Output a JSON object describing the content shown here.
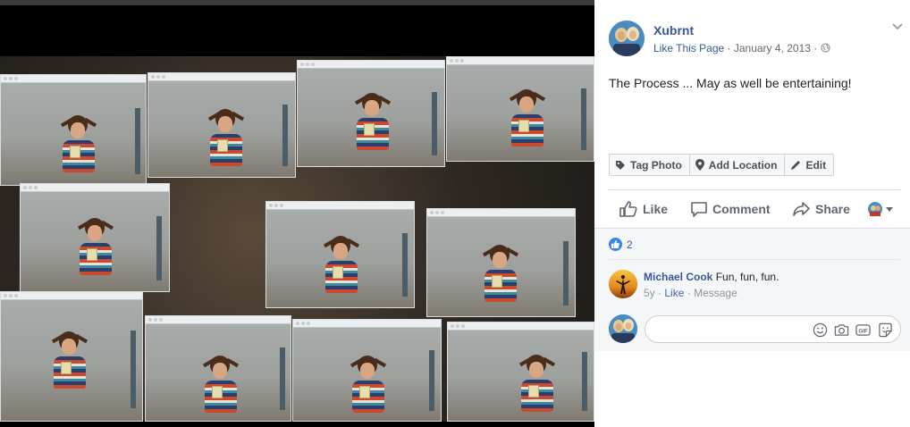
{
  "post": {
    "author": "Xubrnt",
    "like_page": "Like This Page",
    "separator": "·",
    "date": "January 4, 2013",
    "privacy_icon": "globe-icon",
    "menu_icon": "chevron-down-icon",
    "caption": "The Process ... May as well be entertaining!"
  },
  "photo_actions": {
    "tag": "Tag Photo",
    "location": "Add Location",
    "edit": "Edit"
  },
  "reactions": {
    "like": "Like",
    "comment": "Comment",
    "share": "Share"
  },
  "likes": {
    "count": "2"
  },
  "comment": {
    "name": "Michael Cook",
    "text": "Fun, fun, fun.",
    "age": "5y",
    "like": "Like",
    "message": "Message"
  },
  "write_comment": {
    "placeholder": ""
  },
  "colors": {
    "link": "#365899",
    "text": "#1d2129",
    "meta": "#616770",
    "like_blue": "#3b84f0"
  }
}
